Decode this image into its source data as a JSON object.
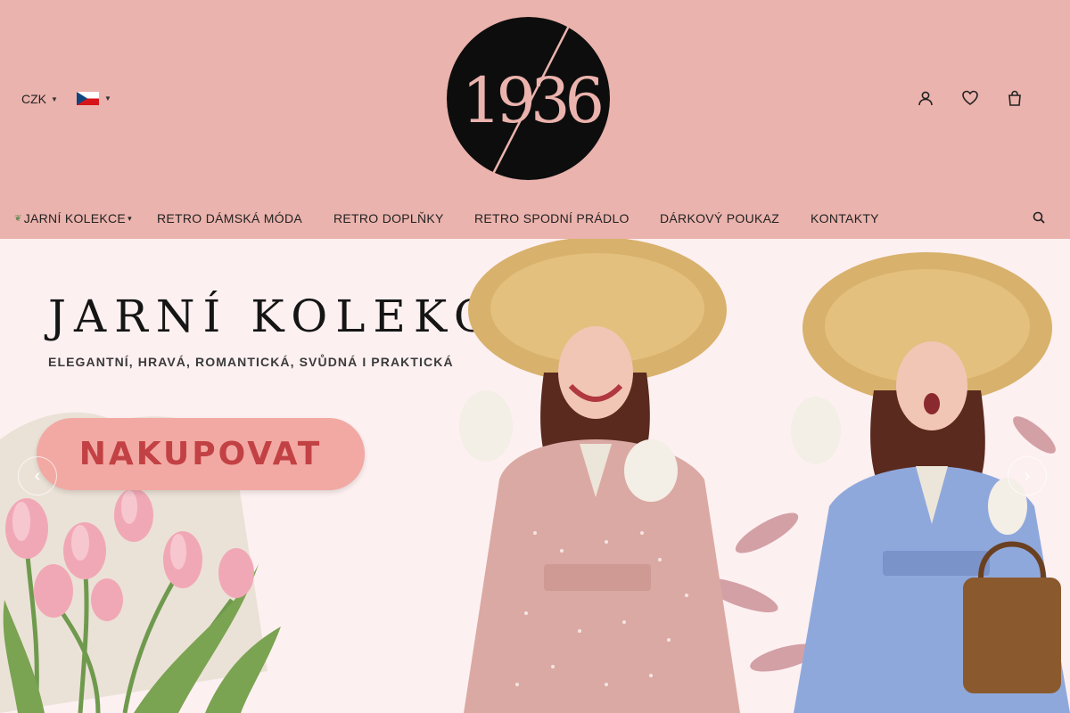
{
  "header": {
    "currency": "CZK",
    "language_flag": "czech-flag",
    "logo_text": "1936",
    "icons": [
      "user-icon",
      "heart-icon",
      "cart-icon"
    ]
  },
  "nav": {
    "items": [
      {
        "label": "JARNÍ KOLEKCE"
      },
      {
        "label": "RETRO DÁMSKÁ MÓDA"
      },
      {
        "label": "RETRO DOPLŇKY"
      },
      {
        "label": "RETRO SPODNÍ PRÁDLO"
      },
      {
        "label": "DÁRKOVÝ POUKAZ"
      },
      {
        "label": "KONTAKTY"
      }
    ]
  },
  "hero": {
    "title": "JARNÍ KOLEKCE",
    "subtitle": "ELEGANTNÍ, HRAVÁ, ROMANTICKÁ, SVŮDNÁ I PRAKTICKÁ",
    "cta": "NAKUPOVAT"
  },
  "colors": {
    "header_bg": "#ebb3ad",
    "hero_bg": "#fdf0f1",
    "cta_bg": "#f2a9a3",
    "cta_text": "#c24144"
  }
}
